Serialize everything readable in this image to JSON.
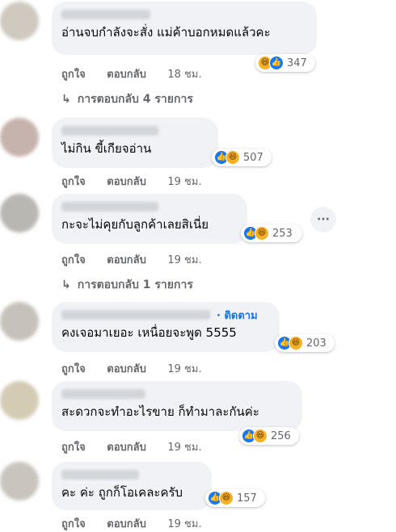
{
  "comments": [
    {
      "text": "อ่านจบกำลังจะสั่ง แม่ค้าบอกหมดแล้วคะ",
      "reaction_count": "347",
      "like_label": "ถูกใจ",
      "reply_label": "ตอบกลับ",
      "time": "18 ชม.",
      "replies_text": "การตอบกลับ 4 รายการ"
    },
    {
      "text": "ไม่กิน ขี้เกียจอ่าน",
      "reaction_count": "507",
      "like_label": "ถูกใจ",
      "reply_label": "ตอบกลับ",
      "time": "19 ชม."
    },
    {
      "text": "กะจะไม่คุยกับลูกค้าเลยสิเนี่ย",
      "reaction_count": "253",
      "like_label": "ถูกใจ",
      "reply_label": "ตอบกลับ",
      "time": "19 ชม.",
      "replies_text": "การตอบกลับ 1 รายการ",
      "more_label": "···"
    },
    {
      "follow_label": "· ติดตาม",
      "text": "คงเจอมาเยอะ เหนื่อยจะพูด 5555",
      "reaction_count": "203",
      "like_label": "ถูกใจ",
      "reply_label": "ตอบกลับ",
      "time": "19 ชม."
    },
    {
      "text": "สะดวกจะทำอะไรขาย ก็ทำมาละกันค่ะ",
      "reaction_count": "256",
      "like_label": "ถูกใจ",
      "reply_label": "ตอบกลับ",
      "time": "19 ชม."
    },
    {
      "text": "คะ ค่ะ ถูกก็โอเคละครับ",
      "reaction_count": "157",
      "like_label": "ถูกใจ",
      "reply_label": "ตอบกลับ",
      "time": "19 ชม."
    }
  ],
  "reply_arrow": "↳",
  "icons": {
    "like": "like-reaction-icon",
    "haha": "haha-reaction-icon"
  },
  "colors": {
    "bubble": "#f0f2f5",
    "like": "#1877f2",
    "haha": "#f7b125",
    "link": "#1b74e4",
    "meta": "#65676b"
  }
}
